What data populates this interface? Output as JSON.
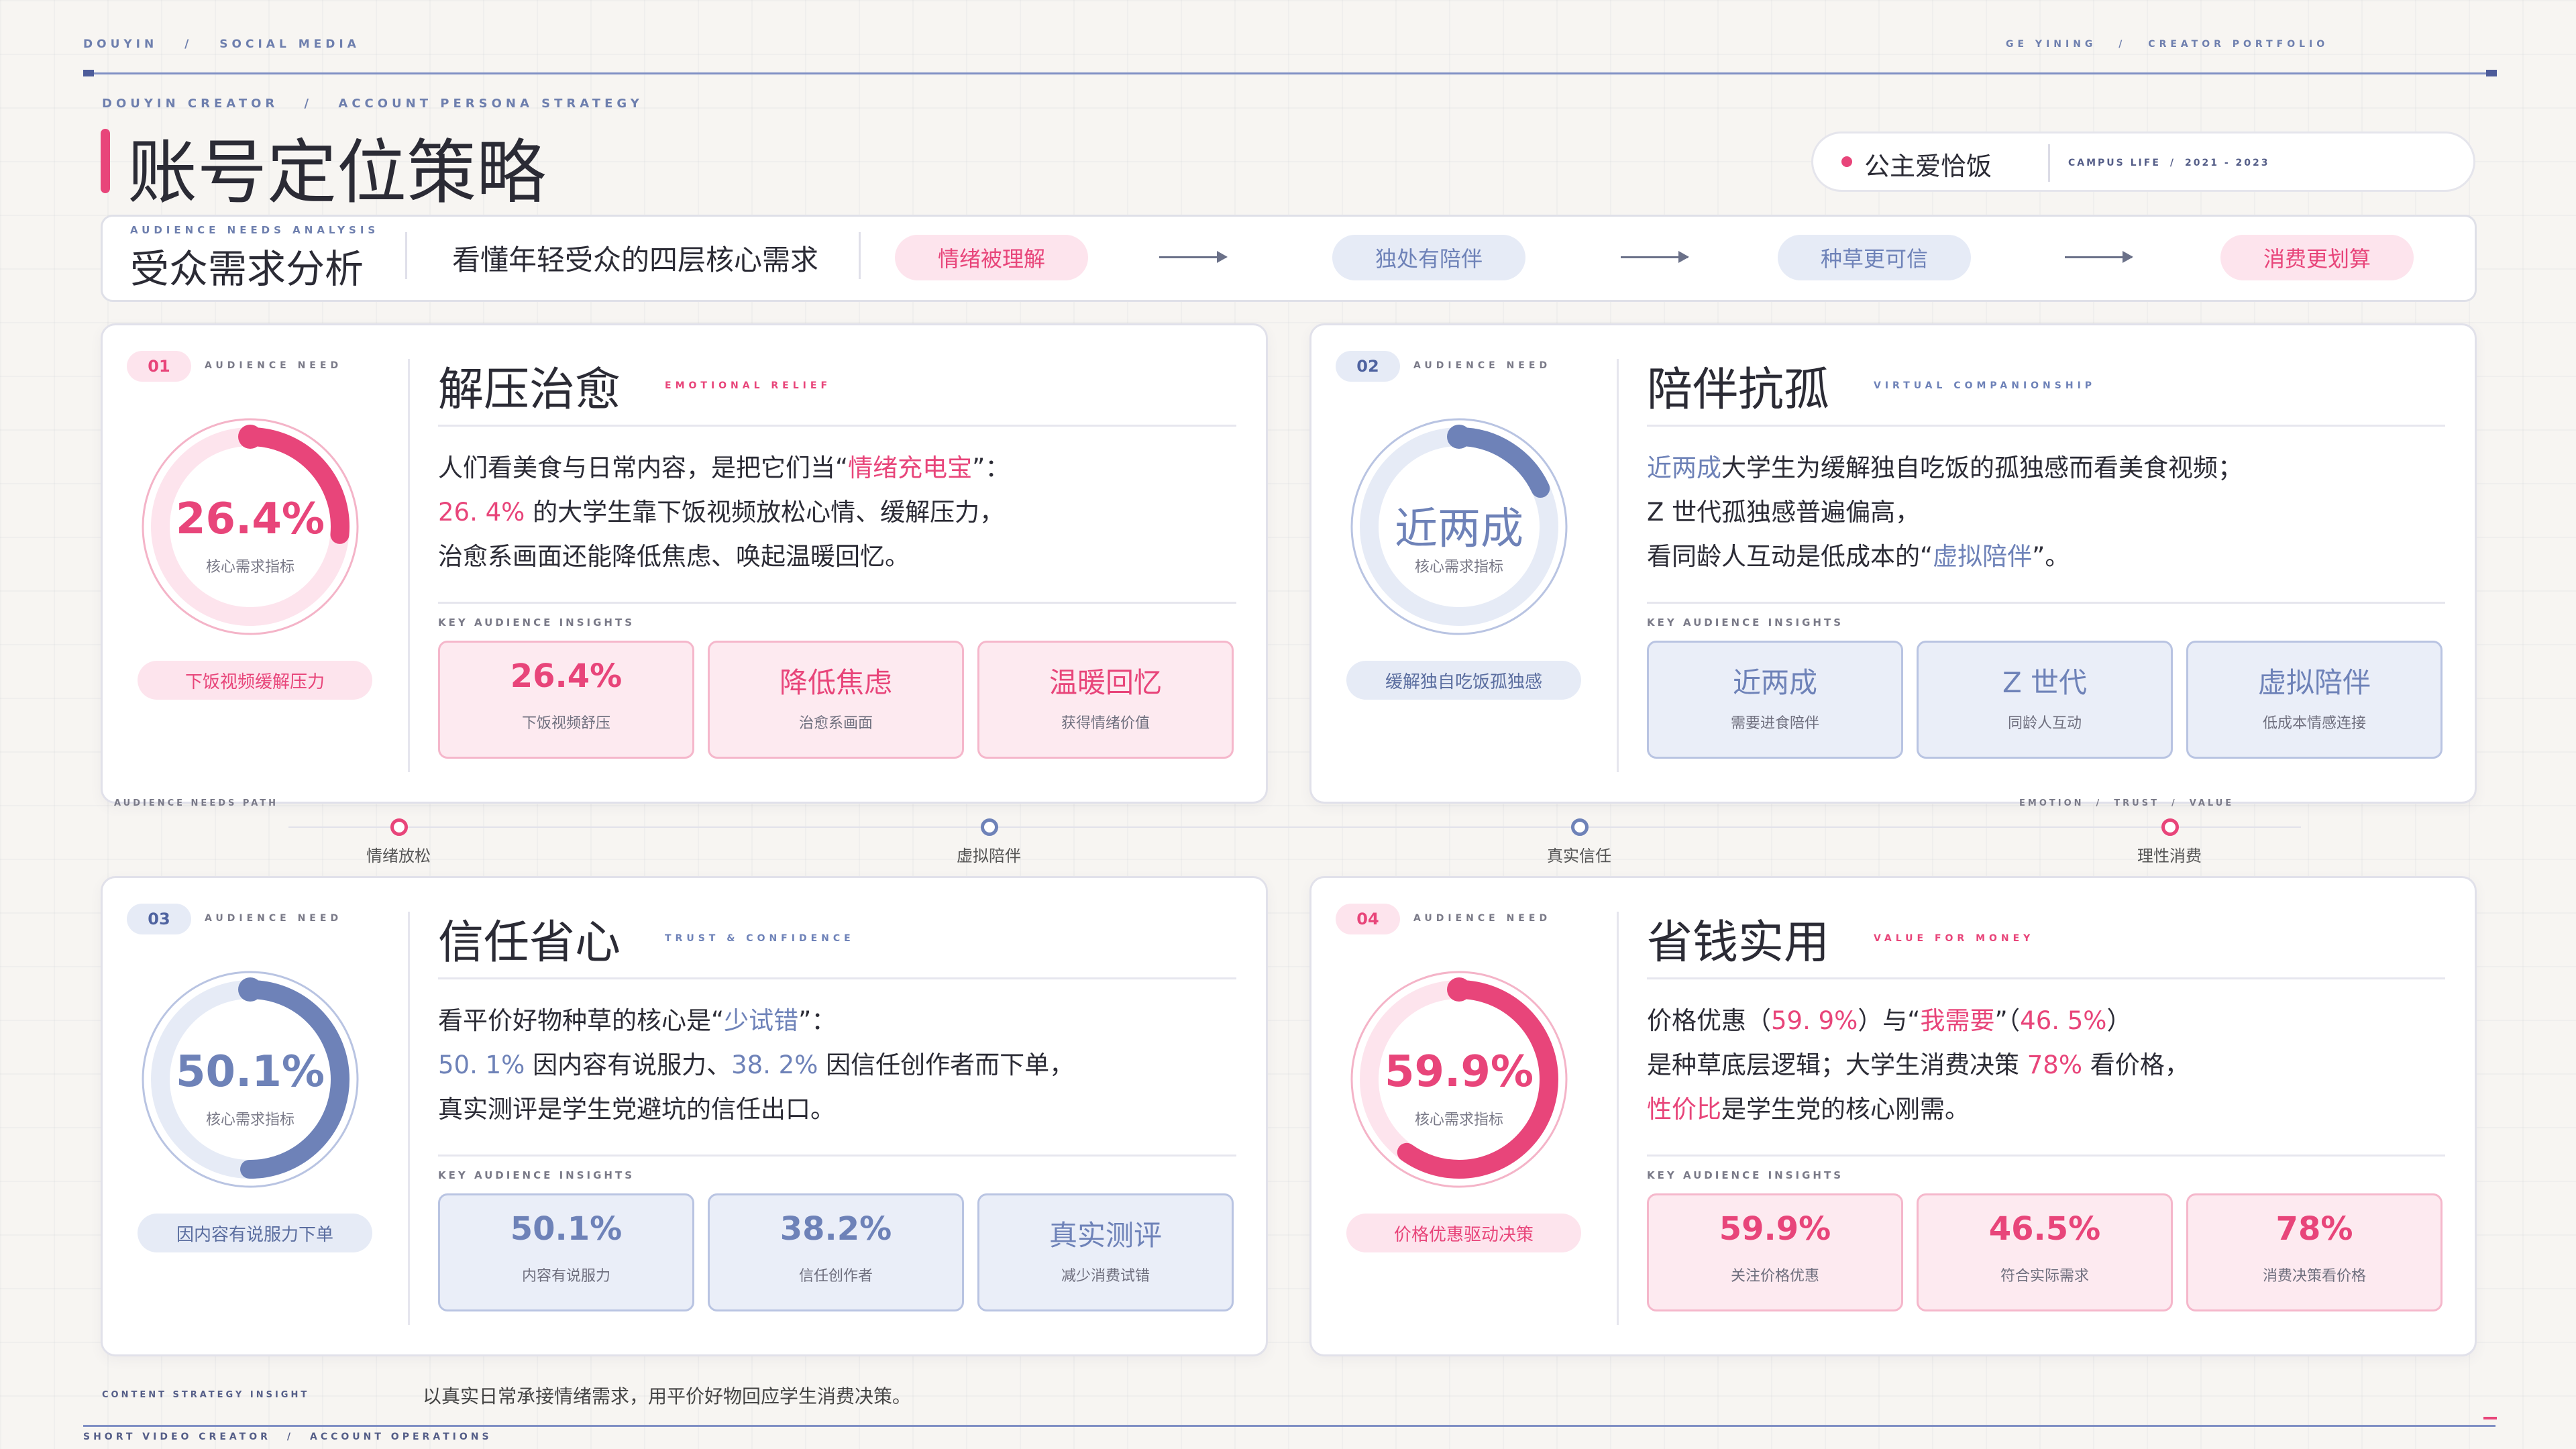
{
  "top_nav": {
    "left_a": "DOUYIN",
    "sep": "/",
    "left_b": "SOCIAL MEDIA",
    "right_a": "GE YINING",
    "right_b": "CREATOR PORTFOLIO"
  },
  "header": {
    "eyebrow_a": "DOUYIN CREATOR",
    "eyebrow_b": "ACCOUNT PERSONA STRATEGY",
    "title": "账号定位策略"
  },
  "account": {
    "name": "公主爱恰饭",
    "meta_a": "CAMPUS LIFE",
    "meta_b": "2021 - 2023"
  },
  "analysis": {
    "eyebrow": "AUDIENCE NEEDS ANALYSIS",
    "title": "受众需求分析",
    "subtitle": "看懂年轻受众的四层核心需求",
    "flow": [
      "情绪被理解",
      "独处有陪伴",
      "种草更可信",
      "消费更划算"
    ]
  },
  "need_label": "AUDIENCE NEED",
  "insights_label": "KEY AUDIENCE INSIGHTS",
  "ring_label": "核心需求指标",
  "cards": [
    {
      "num": "01",
      "title": "解压治愈",
      "en": "EMOTIONAL RELIEF",
      "ring_value": "26.4%",
      "ring_fraction": 0.264,
      "tag": "下饭视频缓解压力",
      "l1a": "人们看美食与日常内容，是把它们当“",
      "l1b": "情绪充电宝",
      "l1c": "”：",
      "l2a": "26. 4%",
      "l2b": " 的大学生靠下饭视频放松心情、缓解压力，",
      "l3": "治愈系画面还能降低焦虑、唤起温暖回忆。",
      "insights": [
        {
          "value": "26.4%",
          "sub": "下饭视频舒压"
        },
        {
          "value": "降低焦虑",
          "sub": "治愈系画面"
        },
        {
          "value": "温暖回忆",
          "sub": "获得情绪价值"
        }
      ]
    },
    {
      "num": "02",
      "title": "陪伴抗孤",
      "en": "VIRTUAL COMPANIONSHIP",
      "ring_value": "近两成",
      "ring_fraction": 0.18,
      "tag": "缓解独自吃饭孤独感",
      "l1a": "近两成",
      "l1b": "大学生为缓解独自吃饭的孤独感而看美食视频；",
      "l2": "Z 世代孤独感普遍偏高，",
      "l3a": "看同龄人互动是低成本的“",
      "l3b": "虚拟陪伴",
      "l3c": "”。",
      "insights": [
        {
          "value": "近两成",
          "sub": "需要进食陪伴"
        },
        {
          "value": "Z 世代",
          "sub": "同龄人互动"
        },
        {
          "value": "虚拟陪伴",
          "sub": "低成本情感连接"
        }
      ]
    },
    {
      "num": "03",
      "title": "信任省心",
      "en": "TRUST & CONFIDENCE",
      "ring_value": "50.1%",
      "ring_fraction": 0.501,
      "tag": "因内容有说服力下单",
      "l1a": "看平价好物种草的核心是“",
      "l1b": "少试错",
      "l1c": "”：",
      "l2a": "50. 1%",
      "l2b": " 因内容有说服力、",
      "l2c": "38. 2%",
      "l2d": " 因信任创作者而下单，",
      "l3": "真实测评是学生党避坑的信任出口。",
      "insights": [
        {
          "value": "50.1%",
          "sub": "内容有说服力"
        },
        {
          "value": "38.2%",
          "sub": "信任创作者"
        },
        {
          "value": "真实测评",
          "sub": "减少消费试错"
        }
      ]
    },
    {
      "num": "04",
      "title": "省钱实用",
      "en": "VALUE FOR MONEY",
      "ring_value": "59.9%",
      "ring_fraction": 0.599,
      "tag": "价格优惠驱动决策",
      "l1a": "价格优惠（",
      "l1b": "59. 9%",
      "l1c": "）与“",
      "l1d": "我需要",
      "l1e": "”（",
      "l1f": "46. 5%",
      "l1g": "）",
      "l2a": "是种草底层逻辑；大学生消费决策 ",
      "l2b": "78%",
      "l2c": " 看价格，",
      "l3a": "性价比",
      "l3b": "是学生党的核心刚需。",
      "insights": [
        {
          "value": "59.9%",
          "sub": "关注价格优惠"
        },
        {
          "value": "46.5%",
          "sub": "符合实际需求"
        },
        {
          "value": "78%",
          "sub": "消费决策看价格"
        }
      ]
    }
  ],
  "path": {
    "label": "AUDIENCE NEEDS PATH",
    "right_a": "EMOTION",
    "right_b": "TRUST",
    "right_c": "VALUE",
    "nodes": [
      "情绪放松",
      "虚拟陪伴",
      "真实信任",
      "理性消费"
    ]
  },
  "footer": {
    "eyebrow": "CONTENT STRATEGY INSIGHT",
    "text": "以真实日常承接情绪需求，用平价好物回应学生消费决策。",
    "bottom_a": "SHORT VIDEO CREATOR",
    "bottom_b": "ACCOUNT OPERATIONS"
  },
  "colors": {
    "pink": "#e8457a",
    "blue": "#6e82b8",
    "pink_soft": "#fde4ed",
    "blue_soft": "#e6ebf6"
  }
}
